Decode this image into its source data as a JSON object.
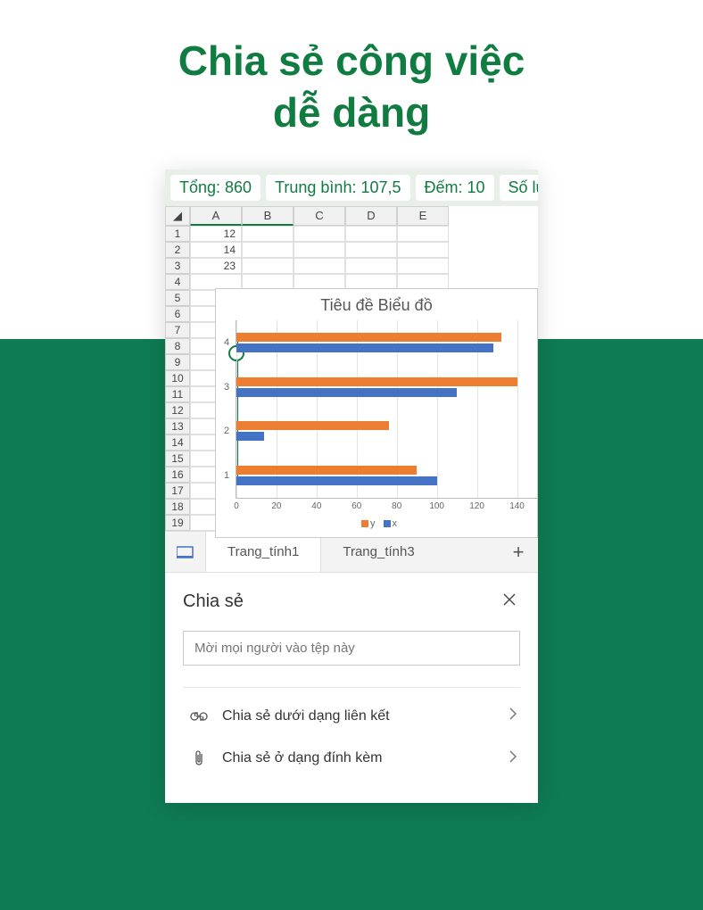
{
  "page_title_line1": "Chia sẻ công việc",
  "page_title_line2": "dễ dàng",
  "stats": {
    "sum": "Tổng: 860",
    "avg": "Trung bình: 107,5",
    "count": "Đếm: 10",
    "overflow": "Số lư"
  },
  "columns": [
    "A",
    "B",
    "C",
    "D",
    "E"
  ],
  "rows": [
    1,
    2,
    3,
    4,
    5,
    6,
    7,
    8,
    9,
    10,
    11,
    12,
    13,
    14,
    15,
    16,
    17,
    18,
    19
  ],
  "cells": {
    "A1": "12",
    "A2": "14",
    "A3": "23"
  },
  "chart_data": {
    "type": "bar",
    "orientation": "horizontal",
    "title": "Tiêu đề Biểu đồ",
    "categories": [
      "1",
      "2",
      "3",
      "4"
    ],
    "series": [
      {
        "name": "y",
        "color": "#ed7d31",
        "values": [
          90,
          76,
          140,
          132
        ]
      },
      {
        "name": "x",
        "color": "#4472c4",
        "values": [
          100,
          14,
          110,
          128
        ]
      }
    ],
    "x_ticks": [
      0,
      20,
      40,
      60,
      80,
      100,
      120,
      140
    ],
    "xlim": [
      0,
      150
    ],
    "ylabel": "",
    "xlabel": ""
  },
  "sheet_tabs": {
    "tab1": "Trang_tính1",
    "tab2": "Trang_tính3"
  },
  "share": {
    "title": "Chia sẻ",
    "invite_placeholder": "Mời mọi người vào tệp này",
    "as_link": "Chia sẻ dưới dạng liên kết",
    "as_attachment": "Chia sẻ ở dạng đính kèm"
  }
}
